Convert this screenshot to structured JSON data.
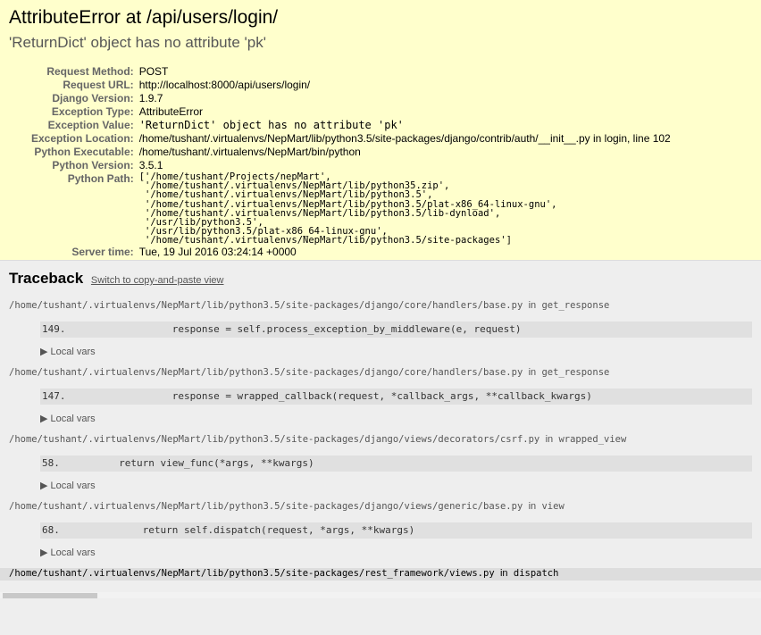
{
  "title": "AttributeError at /api/users/login/",
  "exception_value": "'ReturnDict' object has no attribute 'pk'",
  "meta": [
    {
      "label": "Request Method:",
      "value": "POST"
    },
    {
      "label": "Request URL:",
      "value": "http://localhost:8000/api/users/login/"
    },
    {
      "label": "Django Version:",
      "value": "1.9.7"
    },
    {
      "label": "Exception Type:",
      "value": "AttributeError"
    },
    {
      "label": "Exception Value:",
      "value": "'ReturnDict' object has no attribute 'pk'",
      "mono": true
    },
    {
      "label": "Exception Location:",
      "value": "/home/tushant/.virtualenvs/NepMart/lib/python3.5/site-packages/django/contrib/auth/__init__.py in login, line 102"
    },
    {
      "label": "Python Executable:",
      "value": "/home/tushant/.virtualenvs/NepMart/bin/python"
    },
    {
      "label": "Python Version:",
      "value": "3.5.1"
    },
    {
      "label": "Python Path:",
      "value": "['/home/tushant/Projects/nepMart',\n '/home/tushant/.virtualenvs/NepMart/lib/python35.zip',\n '/home/tushant/.virtualenvs/NepMart/lib/python3.5',\n '/home/tushant/.virtualenvs/NepMart/lib/python3.5/plat-x86_64-linux-gnu',\n '/home/tushant/.virtualenvs/NepMart/lib/python3.5/lib-dynload',\n '/usr/lib/python3.5',\n '/usr/lib/python3.5/plat-x86_64-linux-gnu',\n '/home/tushant/.virtualenvs/NepMart/lib/python3.5/site-packages']",
      "pre": true
    },
    {
      "label": "Server time:",
      "value": "Tue, 19 Jul 2016 03:24:14 +0000"
    }
  ],
  "traceback": {
    "title": "Traceback",
    "switch_link": "Switch to copy-and-paste view",
    "local_vars": "Local vars",
    "in": "in"
  },
  "frames": [
    {
      "file": "/home/tushant/.virtualenvs/NepMart/lib/python3.5/site-packages/django/core/handlers/base.py",
      "func": "get_response",
      "line": "149.",
      "code": "                response = self.process_exception_by_middleware(e, request)"
    },
    {
      "file": "/home/tushant/.virtualenvs/NepMart/lib/python3.5/site-packages/django/core/handlers/base.py",
      "func": "get_response",
      "line": "147.",
      "code": "                response = wrapped_callback(request, *callback_args, **callback_kwargs)"
    },
    {
      "file": "/home/tushant/.virtualenvs/NepMart/lib/python3.5/site-packages/django/views/decorators/csrf.py",
      "func": "wrapped_view",
      "line": "58.",
      "code": "        return view_func(*args, **kwargs)"
    },
    {
      "file": "/home/tushant/.virtualenvs/NepMart/lib/python3.5/site-packages/django/views/generic/base.py",
      "func": "view",
      "line": "68.",
      "code": "            return self.dispatch(request, *args, **kwargs)"
    },
    {
      "file": "/home/tushant/.virtualenvs/NepMart/lib/python3.5/site-packages/rest_framework/views.py",
      "func": "dispatch"
    }
  ]
}
